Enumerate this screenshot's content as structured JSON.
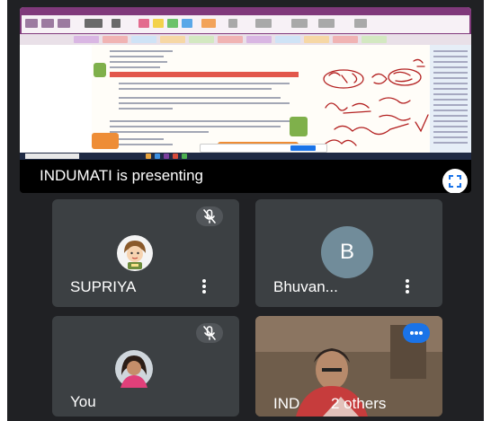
{
  "presentation": {
    "presenter_text": "INDUMATI is presenting",
    "fullscreen_icon": "fullscreen-icon"
  },
  "tiles": [
    {
      "name": "SUPRIYA",
      "muted": true,
      "avatar": "cartoon-photo"
    },
    {
      "name": "Bhuvan...",
      "muted": false,
      "avatar_letter": "B",
      "avatar_color": "#718c9a"
    },
    {
      "name": "You",
      "muted": true,
      "avatar": "profile-photo"
    },
    {
      "name": "IND",
      "others": "2 others",
      "speaking": true
    }
  ],
  "colors": {
    "background": "#202124",
    "tile": "#3c4043",
    "accent": "#1a73e8"
  }
}
